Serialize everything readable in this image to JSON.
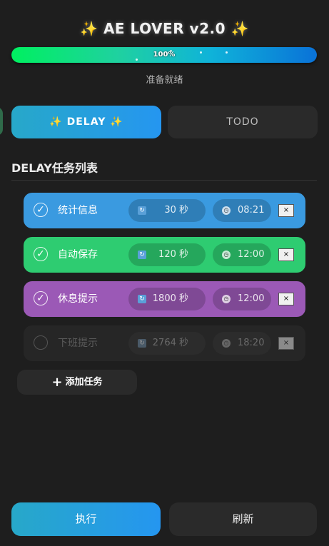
{
  "header": {
    "sparkle": "✨",
    "title": "AE LOVER v2.0"
  },
  "progress": {
    "value": 1.0,
    "label": "100%"
  },
  "status": "准备就绪",
  "tabs": [
    {
      "label": "DELAY",
      "decor": "✨",
      "active": true
    },
    {
      "label": "TODO",
      "active": false
    }
  ],
  "section_title": "DELAY任务列表",
  "tasks": [
    {
      "name": "统计信息",
      "interval": "30 秒",
      "time": "08:21",
      "enabled": true,
      "color": "#3a9ae0"
    },
    {
      "name": "自动保存",
      "interval": "120 秒",
      "time": "12:00",
      "enabled": true,
      "color": "#2ecc71"
    },
    {
      "name": "休息提示",
      "interval": "1800 秒",
      "time": "12:00",
      "enabled": true,
      "color": "#9b59b6"
    },
    {
      "name": "下班提示",
      "interval": "2764 秒",
      "time": "18:20",
      "enabled": false,
      "color": "#262626"
    }
  ],
  "task_icons": {
    "check": "check-icon",
    "interval": "refresh-icon",
    "time": "clock-icon",
    "delete": "close-icon",
    "delete_glyph": "×",
    "check_glyph": "✓"
  },
  "add_task": {
    "icon": "+",
    "label": "添加任务"
  },
  "actions": {
    "run": "执行",
    "refresh": "刷新"
  }
}
